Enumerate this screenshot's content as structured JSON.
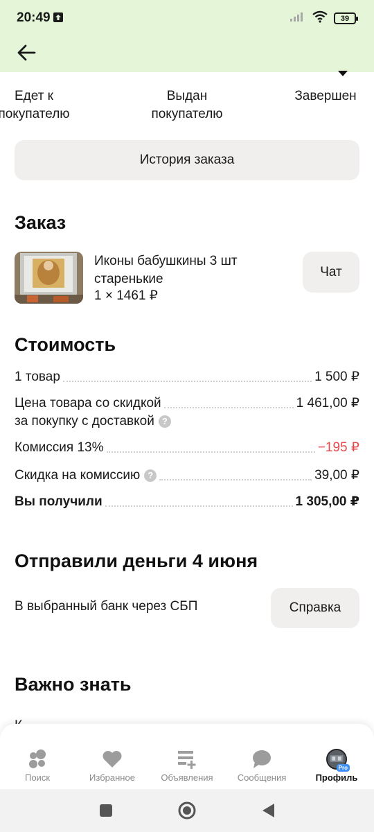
{
  "status_bar": {
    "time": "20:49",
    "battery": "39"
  },
  "tracker": {
    "steps": [
      {
        "label": "Едет к\nпокупателю"
      },
      {
        "label": "Выдан\nпокупателю"
      },
      {
        "label": "Завершен"
      }
    ]
  },
  "history_button": "История заказа",
  "order": {
    "title": "Заказ",
    "item_name_line1": "Иконы бабушкины 3 шт",
    "item_name_line2": "старенькие",
    "item_qty_price": "1 × 1461 ₽",
    "chat_button": "Чат"
  },
  "cost": {
    "title": "Стоимость",
    "rows": [
      {
        "label": "1 товар",
        "value": "1 500 ₽"
      },
      {
        "label_line1": "Цена товара со скидкой",
        "label_line2": "за покупку с доставкой",
        "value": "1 461,00 ₽"
      },
      {
        "label": "Комиссия 13%",
        "value": "−195 ₽"
      },
      {
        "label": "Скидка на комиссию",
        "value": "39,00 ₽"
      },
      {
        "label": "Вы получили",
        "value": "1 305,00 ₽"
      }
    ],
    "help_glyph": "?"
  },
  "payout": {
    "title": "Отправили деньги 4 июня",
    "text": "В выбранный банк через СБП",
    "help_button": "Справка"
  },
  "important": {
    "title": "Важно знать",
    "partial_text": "К"
  },
  "bottom_nav": {
    "items": [
      {
        "label": "Поиск",
        "icon": "search-dots-icon"
      },
      {
        "label": "Избранное",
        "icon": "heart-icon"
      },
      {
        "label": "Объявления",
        "icon": "listings-add-icon"
      },
      {
        "label": "Сообщения",
        "icon": "chat-bubble-icon"
      },
      {
        "label": "Профиль",
        "icon": "profile-avatar-icon",
        "badge": "Pro"
      }
    ]
  },
  "colors": {
    "top_bar": "#e4f5d8",
    "negative": "#e5484d",
    "button_bg": "#f0efed"
  }
}
